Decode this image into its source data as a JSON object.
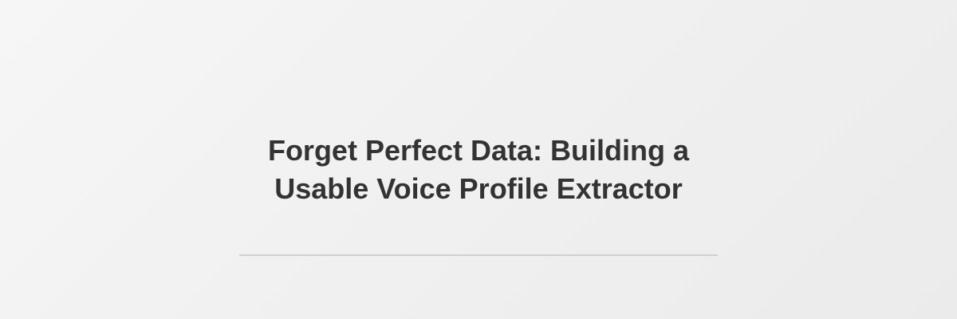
{
  "banner": {
    "title_lines": [
      "Forget Perfect Data: Building a",
      "Usable Voice Profile Extractor"
    ]
  },
  "colors": {
    "title": "#333333",
    "divider": "#d0d0d0",
    "background": "#f0f0f0"
  }
}
